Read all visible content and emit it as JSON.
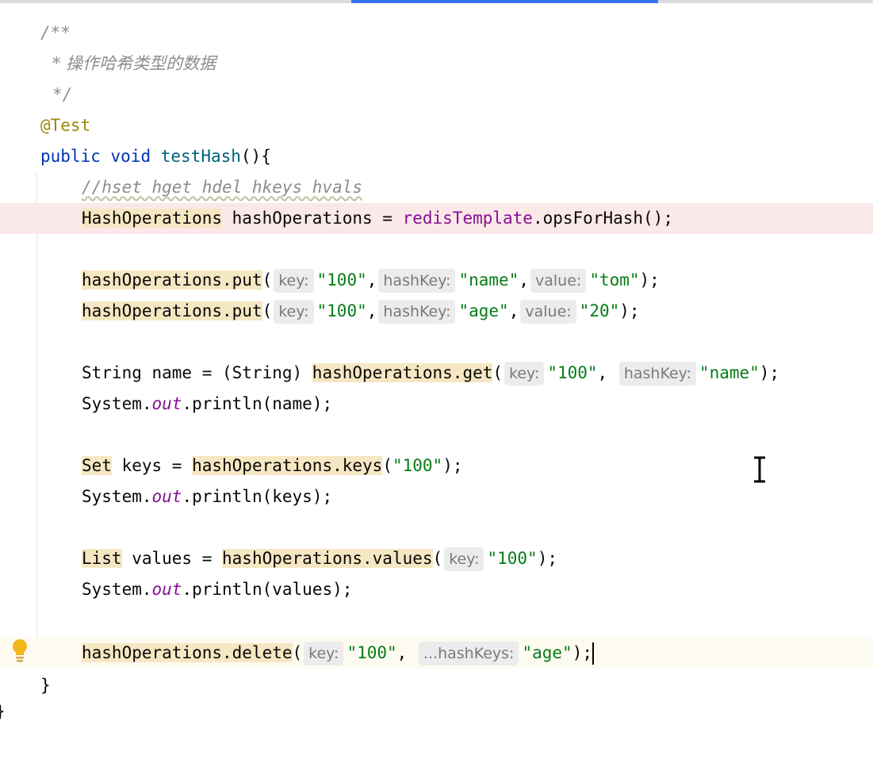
{
  "editor": {
    "lines": [
      {
        "text": "/**"
      },
      {
        "text": "* 操作哈希类型的数据"
      },
      {
        "text": "*/"
      },
      {
        "text": "@Test"
      },
      {
        "kw1": "public",
        "kw2": "void",
        "fn": "testHash",
        "rest": "(){"
      },
      {
        "text": "//hset hget hdel hkeys hvals"
      },
      {
        "type": "HashOperations",
        "var": " hashOperations = ",
        "field": "redisTemplate",
        "rest": ".opsForHash();"
      },
      {},
      {
        "call": "hashOperations.put",
        "p": "(",
        "h1": "key:",
        "s1": "\"100\"",
        "c1": ",",
        "h2": "hashKey:",
        "s2": "\"name\"",
        "c2": ",",
        "h3": "value:",
        "s3": "\"tom\"",
        "end": ");"
      },
      {
        "call": "hashOperations.put",
        "p": "(",
        "h1": "key:",
        "s1": "\"100\"",
        "c1": ",",
        "h2": "hashKey:",
        "s2": "\"age\"",
        "c2": ",",
        "h3": "value:",
        "s3": "\"20\"",
        "end": ");"
      },
      {},
      {
        "pre": "String name = (String) ",
        "call": "hashOperations.get",
        "p": "(",
        "h1": "key:",
        "s1": "\"100\"",
        "c1": ", ",
        "h2": "hashKey:",
        "s2": "\"name\"",
        "end": ");"
      },
      {
        "pre": "System.",
        "static": "out",
        "rest": ".println(name);"
      },
      {},
      {
        "type": "Set",
        "var": " keys = ",
        "call": "hashOperations.keys",
        "p": "(",
        "s1": "\"100\"",
        "end": ");"
      },
      {
        "pre": "System.",
        "static": "out",
        "rest": ".println(keys);"
      },
      {},
      {
        "type": "List",
        "var": " values = ",
        "call": "hashOperations.values",
        "p": "(",
        "h1": "key:",
        "s1": "\"100\"",
        "end": ");"
      },
      {
        "pre": "System.",
        "static": "out",
        "rest": ".println(values);"
      },
      {},
      {
        "call": "hashOperations.delete",
        "p": "(",
        "h1": "key:",
        "s1": "\"100\"",
        "c1": ", ",
        "h2": "...hashKeys:",
        "s2": "\"age\"",
        "end": ");"
      },
      {
        "text": "}"
      }
    ],
    "edge_brace": "}"
  },
  "colors": {
    "error_line": "#fbe8e8",
    "current_line": "#fdfaf0",
    "warning_highlight": "#f6e7c3",
    "keyword": "#0033b3",
    "string": "#067d17",
    "comment": "#8c8c8c",
    "annotation": "#9e880d",
    "accent_tab": "#3574f0"
  },
  "icons": [
    "lightbulb-icon",
    "text-cursor-icon"
  ]
}
